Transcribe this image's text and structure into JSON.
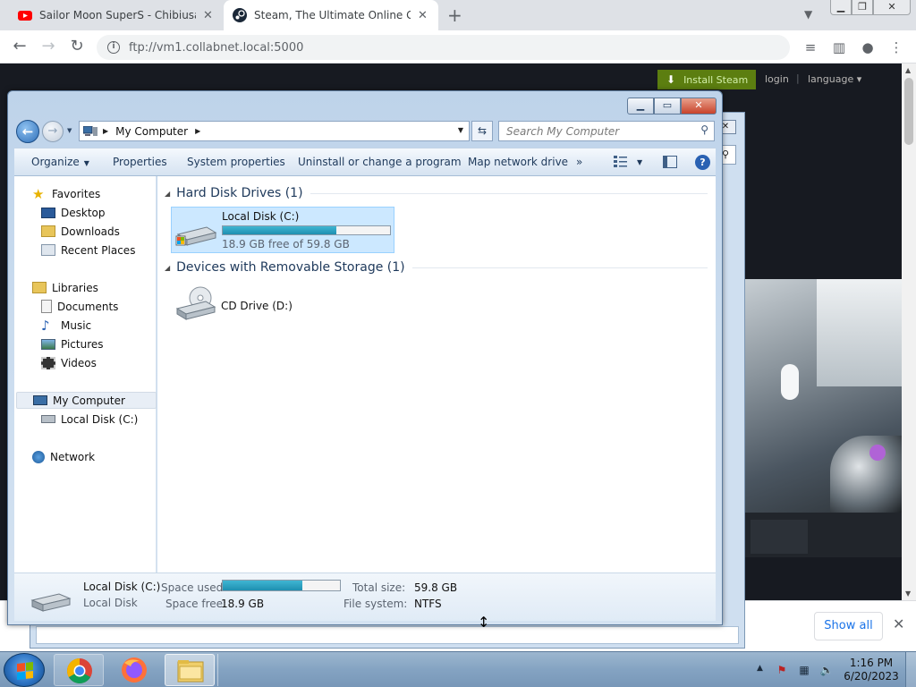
{
  "browser": {
    "tabs": [
      {
        "title": "Sailor Moon SuperS - Chibiusa G",
        "favicon": "youtube-icon",
        "active": false
      },
      {
        "title": "Steam, The Ultimate Online Gam",
        "favicon": "steam-icon",
        "active": true
      }
    ],
    "url": "ftp://vm1.collabnet.local:5000",
    "download_bar": {
      "show_all": "Show all"
    }
  },
  "steam": {
    "install_label": "Install Steam",
    "login_label": "login",
    "separator": "|",
    "language_label": "language",
    "install_color": "#5c7e10"
  },
  "explorer": {
    "breadcrumb": "My Computer",
    "search_placeholder": "Search My Computer",
    "commands": {
      "organize": "Organize",
      "properties": "Properties",
      "system_properties": "System properties",
      "uninstall": "Uninstall or change a program",
      "map_drive": "Map network drive",
      "more": "»"
    },
    "nav": {
      "favorites": "Favorites",
      "desktop": "Desktop",
      "downloads": "Downloads",
      "recent": "Recent Places",
      "libraries": "Libraries",
      "documents": "Documents",
      "music": "Music",
      "pictures": "Pictures",
      "videos": "Videos",
      "my_computer": "My Computer",
      "local_disk": "Local Disk (C:)",
      "network": "Network"
    },
    "groups": {
      "hard_disks": "Hard Disk Drives (1)",
      "removable": "Devices with Removable Storage (1)"
    },
    "drive_c": {
      "name": "Local Disk (C:)",
      "free_text": "18.9 GB free of 59.8 GB",
      "used_fraction": 0.68
    },
    "drive_d": {
      "name": "CD Drive (D:)"
    },
    "details": {
      "title": "Local Disk (C:)",
      "subtitle": "Local Disk",
      "space_used_label": "Space used:",
      "space_free_label": "Space free:",
      "space_free_value": "18.9 GB",
      "total_size_label": "Total size:",
      "total_size_value": "59.8 GB",
      "fs_label": "File system:",
      "fs_value": "NTFS"
    }
  },
  "taskbar": {
    "time": "1:16 PM",
    "date": "6/20/2023",
    "apps": [
      "chrome",
      "firefox",
      "windows-explorer"
    ]
  }
}
